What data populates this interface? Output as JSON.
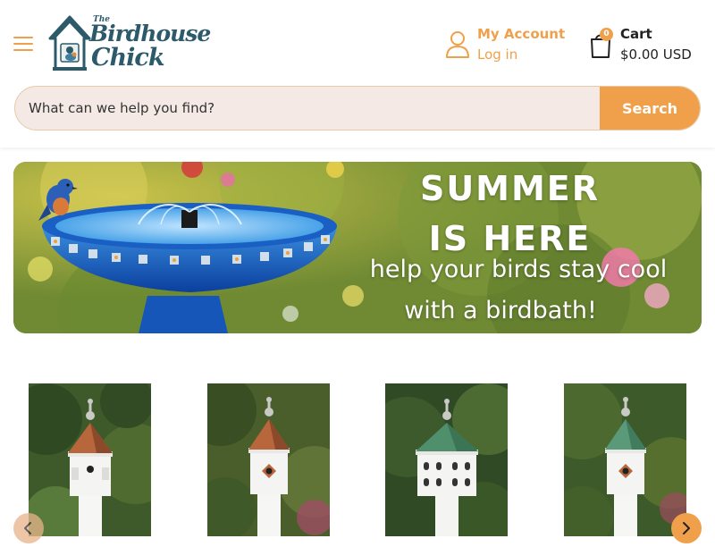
{
  "header": {
    "logo": {
      "line1": "The",
      "line2": "Birdhouse",
      "line3": "Chick"
    },
    "account": {
      "title": "My Account",
      "subtitle": "Log in",
      "icon": "user-icon"
    },
    "cart": {
      "title": "Cart",
      "count": "0",
      "total": "$0.00 USD",
      "icon": "shopping-bag-icon"
    },
    "menu_icon": "hamburger-menu-icon"
  },
  "search": {
    "placeholder": "What can we help you find?",
    "button_label": "Search"
  },
  "banner": {
    "line1": "SUMMER",
    "line2": "IS HERE",
    "line3": "help your birds stay cool",
    "line4": "with a birdbath!"
  },
  "products": [
    {
      "roof": "copper",
      "entrance": "round-hole"
    },
    {
      "roof": "copper",
      "entrance": "diamond-hole"
    },
    {
      "roof": "verdigris",
      "entrance": "multi-hole"
    },
    {
      "roof": "verdigris",
      "entrance": "diamond-hole"
    }
  ],
  "carousel": {
    "prev_icon": "chevron-left-icon",
    "next_icon": "chevron-right-icon"
  },
  "colors": {
    "accent": "#f0a04b",
    "brand": "#2d5a6b",
    "search_bg": "#f4e9e4"
  }
}
